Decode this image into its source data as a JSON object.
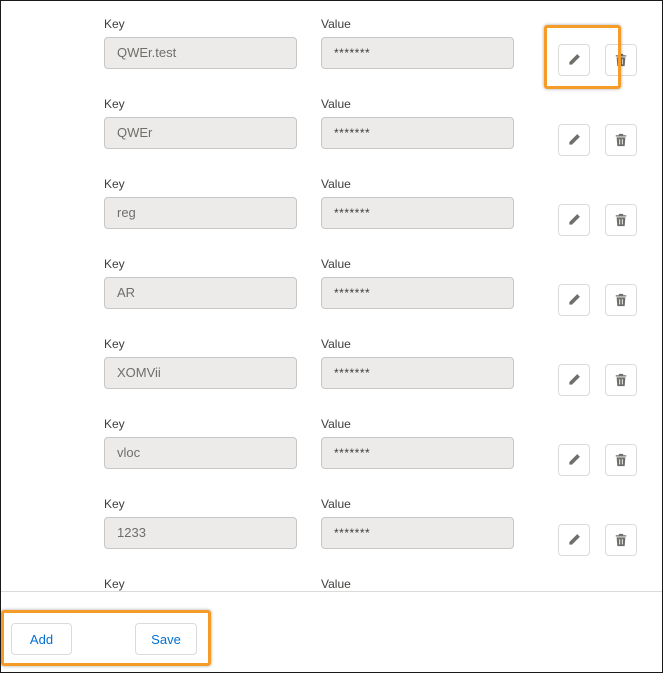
{
  "labels": {
    "key": "Key",
    "value": "Value"
  },
  "rows": [
    {
      "key": "QWEr.test",
      "value": "*******"
    },
    {
      "key": "QWEr",
      "value": "*******"
    },
    {
      "key": "reg",
      "value": "*******"
    },
    {
      "key": "AR",
      "value": "*******"
    },
    {
      "key": "XOMVii",
      "value": "*******"
    },
    {
      "key": "vloc",
      "value": "*******"
    },
    {
      "key": "1233",
      "value": "*******"
    }
  ],
  "partial_row": {
    "key_label": "Key",
    "value_label": "Value"
  },
  "icons": {
    "edit": "pencil-icon",
    "delete": "trash-icon"
  },
  "footer": {
    "add_label": "Add",
    "save_label": "Save"
  },
  "colors": {
    "highlight": "#f49b28",
    "link": "#0070d2"
  }
}
